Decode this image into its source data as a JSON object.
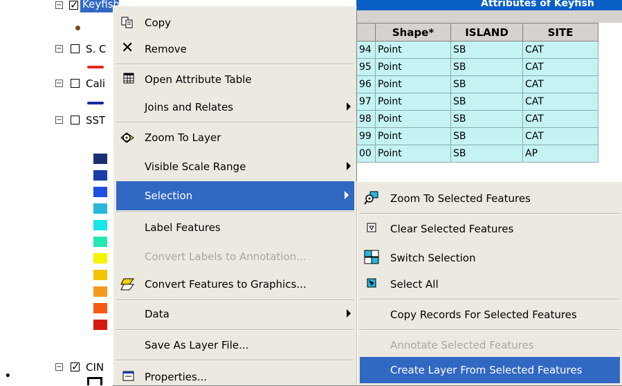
{
  "toc": {
    "layers": [
      {
        "label": "Keyfish",
        "checked": true
      },
      {
        "label": "S. C",
        "checked": false
      },
      {
        "label": "Cali",
        "checked": false
      },
      {
        "label": "SST",
        "checked": false
      },
      {
        "label": "CIN",
        "checked": true
      }
    ],
    "sst_swatches": [
      "#1a2f6e",
      "#1a3da8",
      "#1f4fe0",
      "#29b6d8",
      "#16e6ea",
      "#26e6b6",
      "#f4f400",
      "#f4c400",
      "#f49a1e",
      "#f45a14",
      "#d41a10"
    ],
    "line_symbols": [
      "#e8281c",
      "#1a2a9c"
    ],
    "point_symbol_color": "#7a4a1e"
  },
  "attribute_table": {
    "title": "Attributes of Keyfish",
    "columns": [
      "Shape*",
      "ISLAND",
      "SITE"
    ],
    "row_ids": [
      "94",
      "95",
      "96",
      "97",
      "98",
      "99",
      "00"
    ],
    "rows": [
      [
        "Point",
        "SB",
        "CAT"
      ],
      [
        "Point",
        "SB",
        "CAT"
      ],
      [
        "Point",
        "SB",
        "CAT"
      ],
      [
        "Point",
        "SB",
        "CAT"
      ],
      [
        "Point",
        "SB",
        "CAT"
      ],
      [
        "Point",
        "SB",
        "CAT"
      ],
      [
        "Point",
        "SB",
        "AP"
      ]
    ]
  },
  "context_menu": {
    "items": [
      {
        "label": "Copy",
        "icon": "copy-icon"
      },
      {
        "label": "Remove",
        "icon": "remove-x-icon"
      },
      {
        "label": "Open Attribute Table",
        "icon": "table-icon"
      },
      {
        "label": "Joins and Relates",
        "submenu": true
      },
      {
        "label": "Zoom To Layer",
        "icon": "zoom-to-layer-icon"
      },
      {
        "label": "Visible Scale Range",
        "submenu": true
      },
      {
        "label": "Selection",
        "submenu": true,
        "highlighted": true
      },
      {
        "label": "Label Features"
      },
      {
        "label": "Convert Labels to Annotation...",
        "disabled": true
      },
      {
        "label": "Convert Features to Graphics...",
        "icon": "convert-graphics-icon"
      },
      {
        "label": "Data",
        "submenu": true
      },
      {
        "label": "Save As Layer File..."
      },
      {
        "label": "Properties...",
        "icon": "properties-icon"
      }
    ]
  },
  "selection_submenu": {
    "items": [
      {
        "label": "Zoom To Selected Features",
        "icon": "zoom-selected-icon"
      },
      {
        "label": "Clear Selected Features",
        "icon": "clear-selection-icon"
      },
      {
        "label": "Switch Selection",
        "icon": "switch-selection-icon"
      },
      {
        "label": "Select All",
        "icon": "select-all-icon"
      },
      {
        "label": "Copy Records For Selected Features"
      },
      {
        "label": "Annotate Selected Features",
        "disabled": true
      },
      {
        "label": "Create Layer From Selected Features",
        "highlighted": true
      }
    ]
  },
  "colors": {
    "menu_bg": "#ece9e0",
    "highlight": "#3168c2",
    "grid_cell": "#c5f3f3",
    "title_bar": "#0a5fc7"
  },
  "bullet": "•"
}
